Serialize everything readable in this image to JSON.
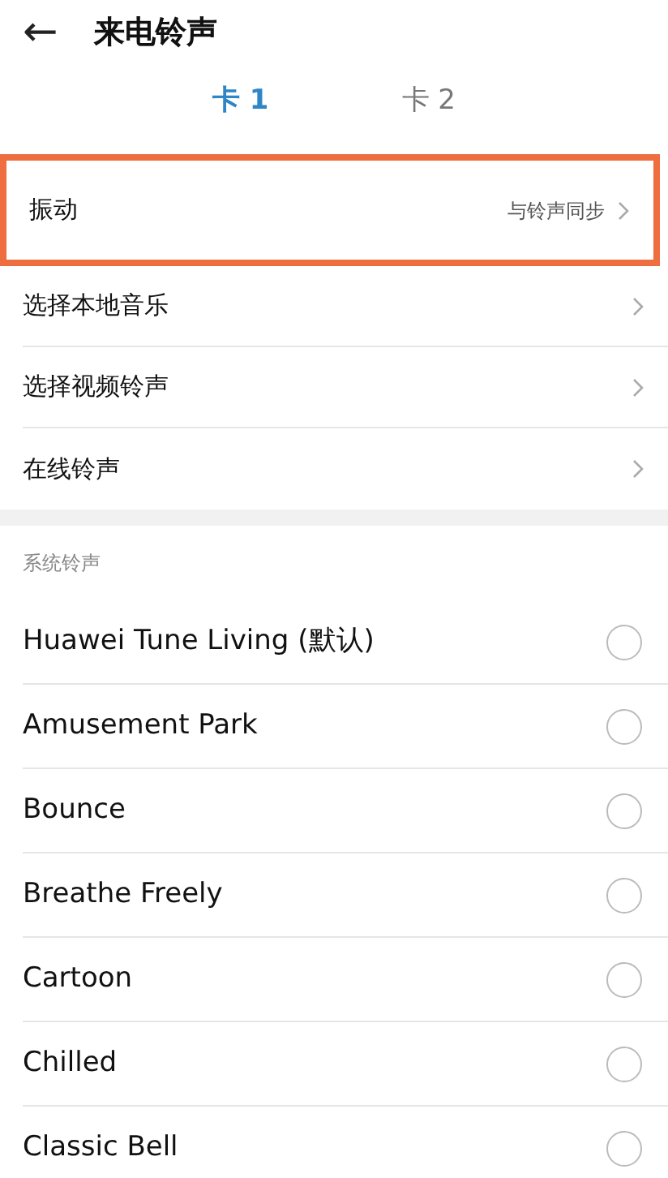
{
  "header": {
    "back": "←",
    "title": "来电铃声"
  },
  "tabs": [
    {
      "label": "卡 1",
      "selected": true
    },
    {
      "label": "卡 2",
      "selected": false
    }
  ],
  "vibration": {
    "label": "振动",
    "value": "与铃声同步",
    "highlighted": true
  },
  "menu_rows": [
    {
      "label": "选择本地音乐"
    },
    {
      "label": "选择视频铃声"
    },
    {
      "label": "在线铃声"
    }
  ],
  "section_title": "系统铃声",
  "ringtones": [
    {
      "label": "Huawei Tune Living (默认)",
      "selected": false
    },
    {
      "label": "Amusement Park",
      "selected": false
    },
    {
      "label": "Bounce",
      "selected": false
    },
    {
      "label": "Breathe Freely",
      "selected": false
    },
    {
      "label": "Cartoon",
      "selected": false
    },
    {
      "label": "Chilled",
      "selected": false
    },
    {
      "label": "Classic Bell",
      "selected": false
    }
  ]
}
